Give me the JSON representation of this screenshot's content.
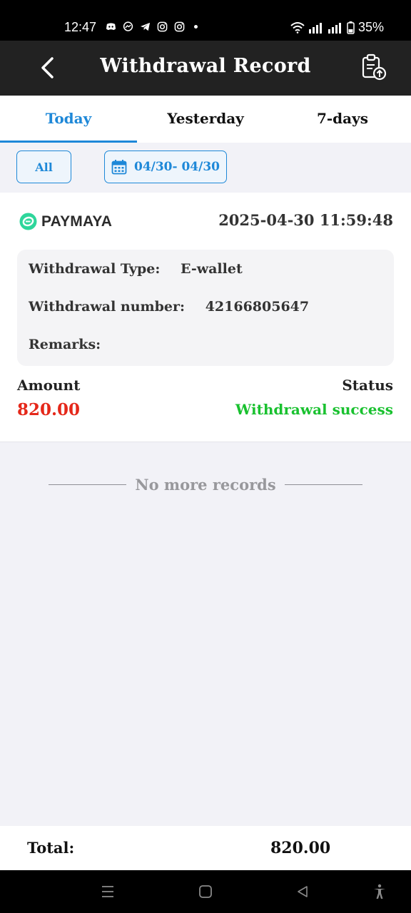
{
  "status_bar": {
    "time": "12:47",
    "battery": "35%",
    "left_icons": [
      "discord-icon",
      "messenger-icon",
      "telegram-icon",
      "instagram-icon",
      "instagram-icon"
    ],
    "right_icons": [
      "wifi-icon",
      "signal-icon",
      "signal-icon",
      "battery-icon"
    ]
  },
  "header": {
    "title": "Withdrawal Record",
    "back_icon": "chevron-left-icon",
    "action_icon": "clipboard-upload-icon"
  },
  "tabs": [
    {
      "label": "Today",
      "active": true
    },
    {
      "label": "Yesterday",
      "active": false
    },
    {
      "label": "7-days",
      "active": false
    }
  ],
  "filters": {
    "all_label": "All",
    "date_range": "04/30- 04/30",
    "date_icon": "calendar-icon"
  },
  "record": {
    "provider": "PAYMAYA",
    "datetime": "2025-04-30 11:59:48",
    "type_label": "Withdrawal Type",
    "type_value": "E-wallet",
    "number_label": "Withdrawal number",
    "number_value": "42166805647",
    "remarks_label": "Remarks",
    "remarks_value": "",
    "amount_label": "Amount",
    "amount_value": "820.00",
    "status_label": "Status",
    "status_value": "Withdrawal success"
  },
  "list_end_text": "No more records",
  "footer": {
    "total_label": "Total:",
    "total_value": "820.00"
  },
  "colors": {
    "accent": "#1e88d8",
    "amount": "#e5281a",
    "success": "#19c12f",
    "header_bg": "#222222"
  }
}
